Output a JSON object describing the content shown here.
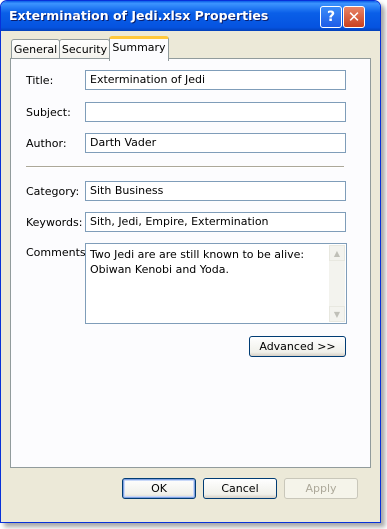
{
  "window": {
    "title": "Extermination of Jedi.xlsx Properties",
    "help_glyph": "?",
    "close_glyph": "✕"
  },
  "tabs": [
    {
      "label": "General",
      "active": false
    },
    {
      "label": "Security",
      "active": false
    },
    {
      "label": "Summary",
      "active": true
    }
  ],
  "fields": {
    "title": {
      "label": "Title:",
      "value": "Extermination of Jedi"
    },
    "subject": {
      "label": "Subject:",
      "value": ""
    },
    "author": {
      "label": "Author:",
      "value": "Darth Vader"
    },
    "category": {
      "label": "Category:",
      "value": "Sith Business"
    },
    "keywords": {
      "label": "Keywords:",
      "value": "Sith, Jedi, Empire, Extermination"
    },
    "comments": {
      "label": "Comments:",
      "value": "Two Jedi are are still known to be alive: Obiwan Kenobi and Yoda."
    }
  },
  "buttons": {
    "advanced": "Advanced >>",
    "ok": "OK",
    "cancel": "Cancel",
    "apply": "Apply"
  }
}
